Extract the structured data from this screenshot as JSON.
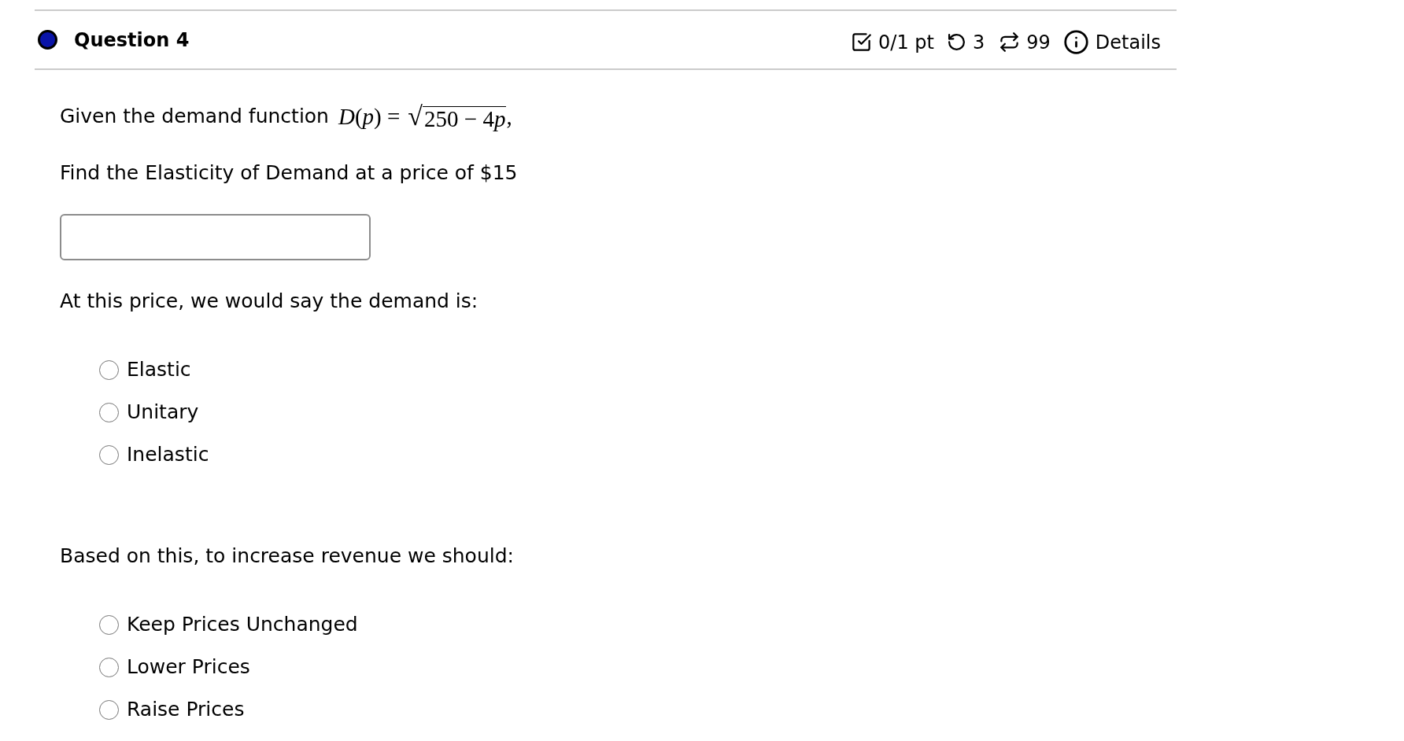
{
  "header": {
    "title": "Question 4",
    "score": "0/1 pt",
    "retries": "3",
    "attempts": "99",
    "details": "Details"
  },
  "intro": {
    "text": "Given the demand function",
    "formula": {
      "lhs": "*D*(*p*) =",
      "radical": "√",
      "radicand": "250 − 4",
      "variable": "p",
      "tail": ","
    }
  },
  "parts": [
    {
      "kind": "input",
      "prompt": "Find the Elasticity of Demand at a price of $15"
    },
    {
      "kind": "radio",
      "prompt": "At this price, we would say the demand is:",
      "options": [
        {
          "label": "Elastic",
          "selected": false
        },
        {
          "label": "Unitary",
          "selected": false
        },
        {
          "label": "Inelastic",
          "selected": false
        }
      ]
    },
    {
      "kind": "radio",
      "prompt": "Based on this, to increase revenue we should:",
      "options": [
        {
          "label": "Keep Prices Unchanged",
          "selected": false
        },
        {
          "label": "Lower Prices",
          "selected": false
        },
        {
          "label": "Raise Prices",
          "selected": false
        }
      ]
    }
  ]
}
